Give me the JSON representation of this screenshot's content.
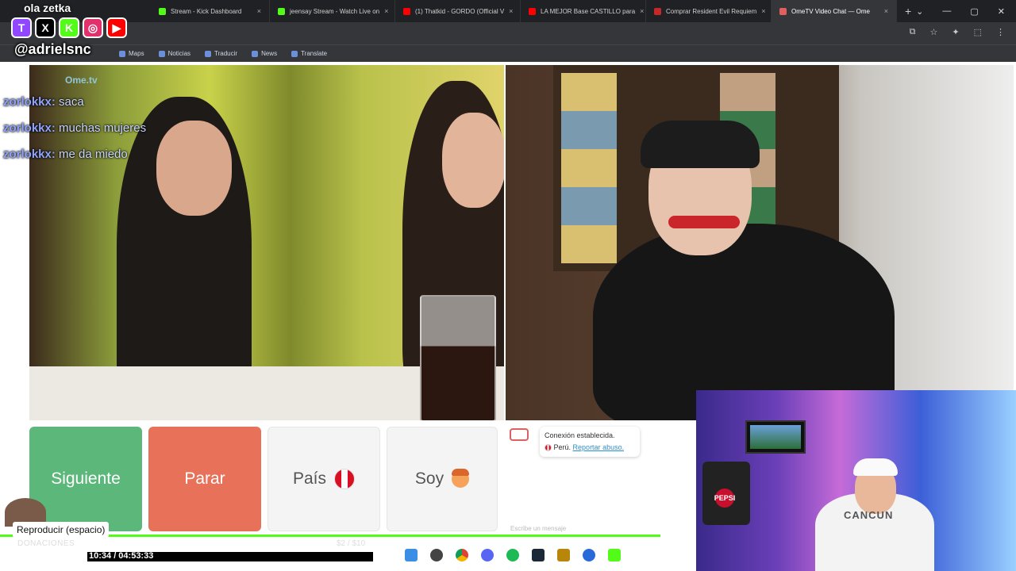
{
  "tabs": [
    {
      "label": "Stream - Kick Dashboard",
      "color": "#53fc18"
    },
    {
      "label": "jeensay Stream - Watch Live on",
      "color": "#53fc18"
    },
    {
      "label": "(1) Thatkid - GORDO (Official V",
      "color": "#ff0000"
    },
    {
      "label": "LA MEJOR Base CASTILLO para",
      "color": "#ff0000"
    },
    {
      "label": "Comprar Resident Evil Requiem",
      "color": "#c62828"
    },
    {
      "label": "OmeTV Video Chat — Ome",
      "color": "#e06060"
    }
  ],
  "bookmarks": [
    "Maps",
    "Noticias",
    "Traducir",
    "News",
    "Translate"
  ],
  "overlay": {
    "top_chat": "ola zetka",
    "handle": "@adrielsnc",
    "brands": [
      {
        "glyph": "T",
        "name": "twitch-icon",
        "color": "#9146ff"
      },
      {
        "glyph": "X",
        "name": "x-icon",
        "color": "#000000"
      },
      {
        "glyph": "K",
        "name": "kick-icon",
        "color": "#53fc18"
      },
      {
        "glyph": "◎",
        "name": "instagram-icon",
        "color": "#e1306c"
      },
      {
        "glyph": "▶",
        "name": "youtube-icon",
        "color": "#ff0000"
      }
    ],
    "chat": [
      {
        "user": "zorlokkx:",
        "msg": "saca"
      },
      {
        "user": "zorlokkx:",
        "msg": "muchas mujeres"
      },
      {
        "user": "zorlokkx:",
        "msg": "me da miedo"
      }
    ]
  },
  "ome": {
    "logo": "Ome.tv",
    "buttons": {
      "next": "Siguiente",
      "stop": "Parar",
      "country": "País",
      "me": "Soy"
    },
    "system_msg": {
      "title": "Conexión establecida.",
      "country": "Perú.",
      "report": "Reportar abuso."
    },
    "input_placeholder": "Escribe un mensaje"
  },
  "webcam": {
    "shirt_text": "CANCUN",
    "pepsi": "PEPSI"
  },
  "player": {
    "tooltip": "Reproducir (espacio)",
    "donations_label": "DONACIONES",
    "donation_amount": "$2 / $10",
    "donation_progress": 0.2,
    "time": "10:34 / 04:53:33",
    "playback_progress": 0.65
  }
}
